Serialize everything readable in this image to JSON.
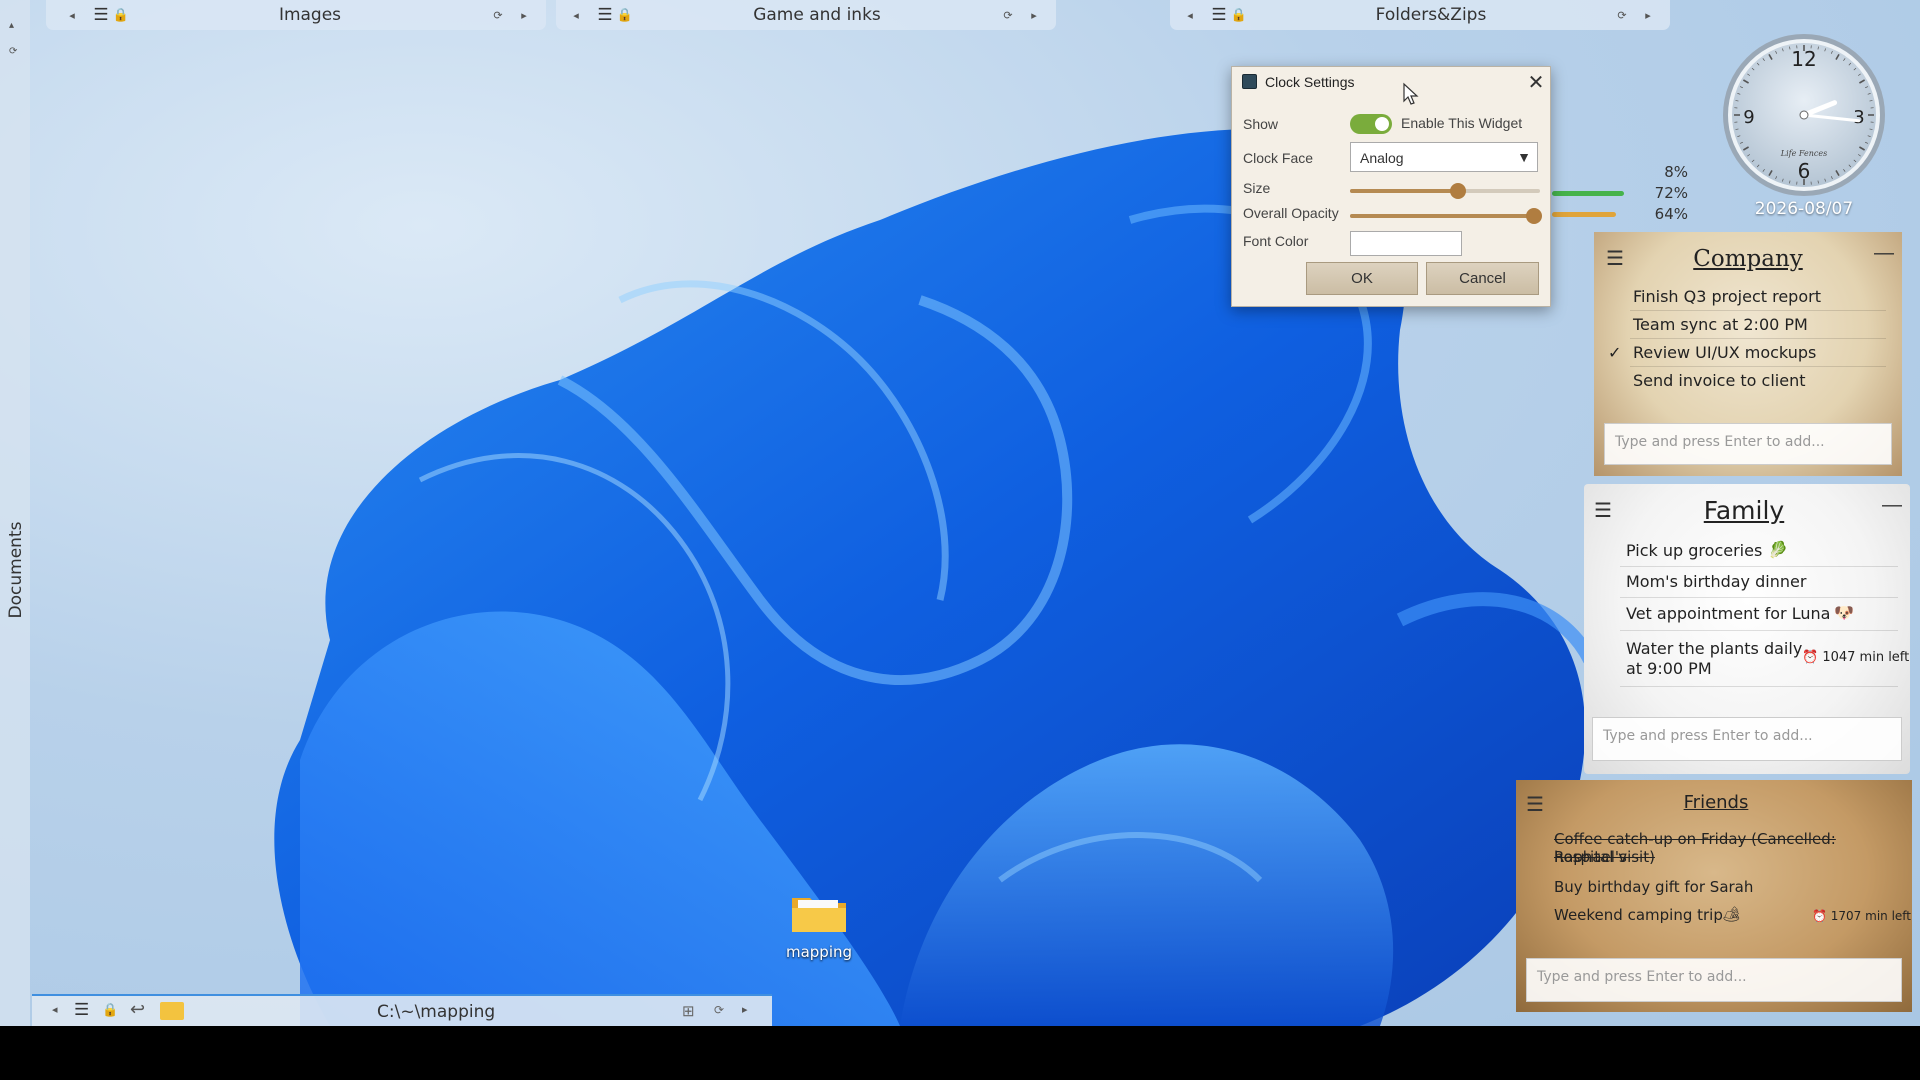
{
  "fences": [
    {
      "title": "Images"
    },
    {
      "title": "Game and inks"
    },
    {
      "title": "Folders&Zips"
    }
  ],
  "left_fence": {
    "title": "Documents"
  },
  "bottom_fence": {
    "path": "C:\\~\\mapping"
  },
  "desktop_icon": {
    "label": "mapping"
  },
  "dialog": {
    "title": "Clock Settings",
    "show_label": "Show",
    "enable_label": "Enable This Widget",
    "enabled": true,
    "clock_face_label": "Clock Face",
    "clock_face_value": "Analog",
    "size_label": "Size",
    "size_level": 0.57,
    "opacity_label": "Overall Opacity",
    "opacity_level": 0.97,
    "font_color_label": "Font Color",
    "ok_label": "OK",
    "cancel_label": "Cancel"
  },
  "clock": {
    "numerals": [
      "12",
      "3",
      "6",
      "9"
    ],
    "brand": "Life Fences",
    "date": "2026-08/07",
    "time": {
      "hour": 2,
      "minute": 16
    }
  },
  "meters": [
    {
      "value": "8%",
      "color": "#46b34b"
    },
    {
      "value": "72%",
      "color": "#46b34b"
    },
    {
      "value": "64%",
      "color": "#e0a43a"
    }
  ],
  "todos": {
    "company": {
      "title": "Company",
      "items": [
        {
          "text": "Finish Q3 project report",
          "done": false
        },
        {
          "text": "Team sync at 2:00 PM",
          "done": false
        },
        {
          "text": "Review UI/UX mockups",
          "done": true
        },
        {
          "text": "Send invoice to client",
          "done": false
        }
      ],
      "placeholder": "Type and press Enter to add..."
    },
    "family": {
      "title": "Family",
      "items": [
        {
          "text": "Pick up groceries",
          "emoji": "🥬"
        },
        {
          "text": "Mom's birthday dinner"
        },
        {
          "text": "Vet appointment for Luna",
          "emoji": "🐶"
        },
        {
          "text_line1": "Water the plants daily",
          "text_line2": "at 9:00 PM",
          "badge": "1047 min left"
        }
      ],
      "placeholder": "Type and press Enter to add..."
    },
    "friends": {
      "title": "Friends",
      "items": [
        {
          "text_line1": "Coffee catch-up on Friday (Cancelled: Raphael's",
          "text_line2": "hospital visit)",
          "struck": true
        },
        {
          "text": "Buy birthday gift for Sarah"
        },
        {
          "text": "Weekend camping trip",
          "emoji": "🏕",
          "badge": "1707 min left"
        }
      ],
      "placeholder": "Type and press Enter to add..."
    }
  }
}
